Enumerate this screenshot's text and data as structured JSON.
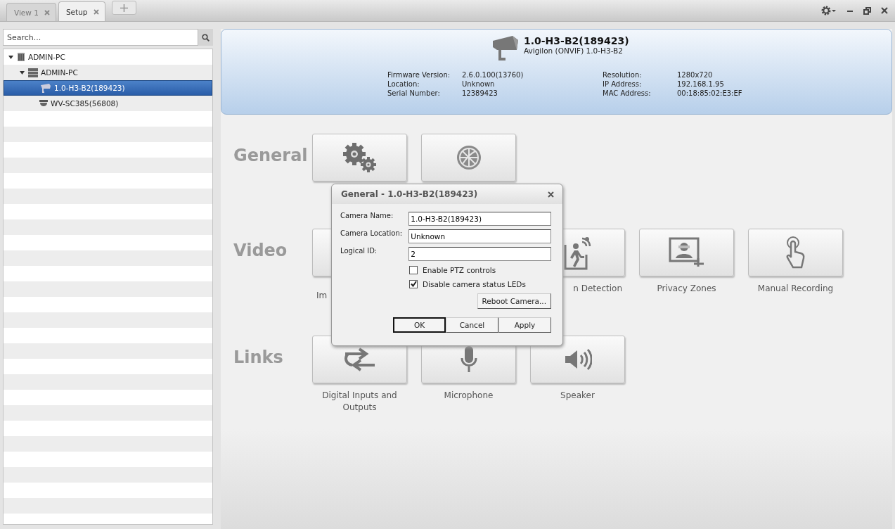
{
  "tabs": [
    {
      "label": "View 1",
      "selected": false
    },
    {
      "label": "Setup",
      "selected": true
    }
  ],
  "search": {
    "placeholder": "Search..."
  },
  "tree": [
    {
      "label": "ADMIN-PC",
      "kind": "site",
      "expanded": true,
      "selected": false,
      "children": [
        {
          "label": "ADMIN-PC",
          "kind": "server",
          "expanded": true,
          "selected": false,
          "children": [
            {
              "label": "1.0-H3-B2(189423)",
              "kind": "camera",
              "selected": true
            },
            {
              "label": "WV-SC385(56808)",
              "kind": "dome",
              "selected": false
            }
          ]
        }
      ]
    }
  ],
  "header": {
    "title": "1.0-H3-B2(189423)",
    "subtitle": "Avigilon (ONVIF) 1.0-H3-B2",
    "left_fields": [
      {
        "label": "Firmware Version:",
        "value": "2.6.0.100(13760)"
      },
      {
        "label": "Location:",
        "value": "Unknown"
      },
      {
        "label": "Serial Number:",
        "value": "12389423"
      }
    ],
    "right_fields": [
      {
        "label": "Resolution:",
        "value": "1280x720"
      },
      {
        "label": "IP Address:",
        "value": "192.168.1.95"
      },
      {
        "label": "MAC Address:",
        "value": "00:18:85:02:E3:EF"
      }
    ]
  },
  "sections": [
    {
      "title": "General",
      "tiles": [
        {
          "kind": "gears"
        },
        {
          "kind": "globe"
        }
      ]
    },
    {
      "title": "Video",
      "tiles": [
        {
          "kind": "covered",
          "label": "Im"
        },
        {
          "kind": "motion",
          "label": "n Detection",
          "label_clipped": true
        },
        {
          "kind": "privacy",
          "label": "Privacy Zones"
        },
        {
          "kind": "touch",
          "label": "Manual Recording"
        }
      ]
    },
    {
      "title": "Links",
      "tiles": [
        {
          "kind": "arrows",
          "label": "Digital Inputs and Outputs"
        },
        {
          "kind": "mic",
          "label": "Microphone"
        },
        {
          "kind": "speaker",
          "label": "Speaker"
        }
      ]
    }
  ],
  "dialog": {
    "title": "General - 1.0-H3-B2(189423)",
    "fields": [
      {
        "label": "Camera Name:",
        "value": "1.0-H3-B2(189423)"
      },
      {
        "label": "Camera Location:",
        "value": "Unknown"
      },
      {
        "label": "Logical ID:",
        "value": "2"
      }
    ],
    "checkboxes": [
      {
        "label": "Enable PTZ controls",
        "checked": false
      },
      {
        "label": "Disable camera status LEDs",
        "checked": true
      }
    ],
    "reboot": "Reboot Camera...",
    "buttons": [
      {
        "label": "OK",
        "default": true
      },
      {
        "label": "Cancel",
        "default": false
      },
      {
        "label": "Apply",
        "default": false
      }
    ]
  }
}
